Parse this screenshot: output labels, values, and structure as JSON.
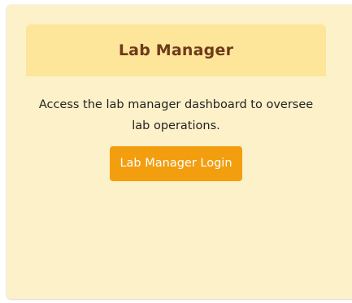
{
  "card": {
    "title": "Lab Manager",
    "description": "Access the lab manager dashboard to oversee lab operations.",
    "button_label": "Lab Manager Login"
  },
  "colors": {
    "panel_background": "#fdf1c9",
    "header_background": "#fde59a",
    "title_text": "#6e3a1a",
    "button_background": "#f29e0f",
    "button_text": "#ffffff"
  }
}
